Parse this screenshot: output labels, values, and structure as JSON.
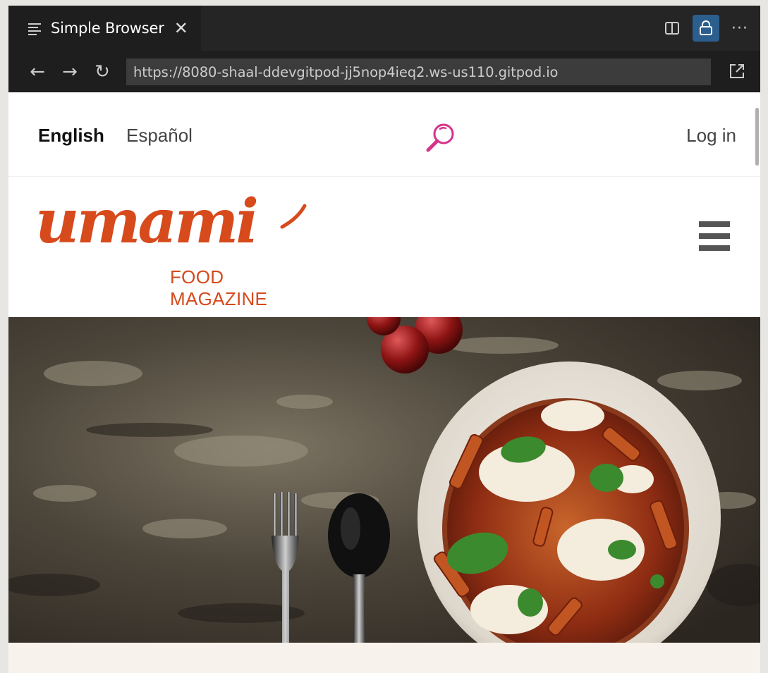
{
  "tab": {
    "title": "Simple Browser",
    "close_glyph": "✕",
    "icon": "preview-lines-icon"
  },
  "toolbar": {
    "split_icon": "split-editor-icon",
    "lock_icon": "lock-icon",
    "more_glyph": "···"
  },
  "nav": {
    "back_glyph": "←",
    "forward_glyph": "→",
    "reload_glyph": "↻",
    "url": "https://8080-shaal-ddevgitpod-jj5nop4ieq2.ws-us110.gitpod.io",
    "open_external_icon": "open-external-icon"
  },
  "site": {
    "languages": [
      "English",
      "Español"
    ],
    "active_language": "English",
    "login_label": "Log in",
    "logo_script": "umami",
    "logo_subtitle": "FOOD MAGAZINE",
    "brand_color": "#d64a1c",
    "search_color": "#d6338c"
  },
  "hero": {
    "icon": "pasta-dish-photo"
  }
}
